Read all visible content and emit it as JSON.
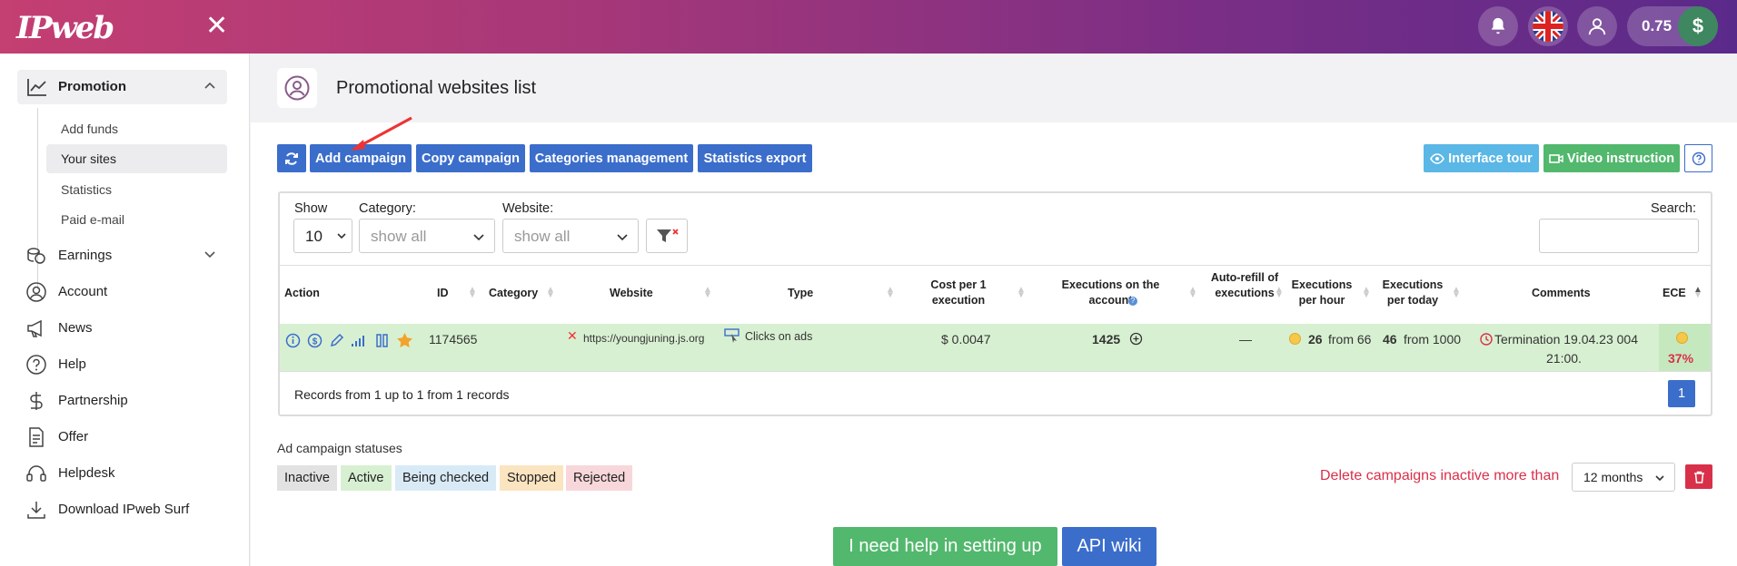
{
  "header": {
    "logo": "IPweb",
    "close_glyph": "✕",
    "balance": "0.75",
    "currency_glyph": "$",
    "icons": [
      "bell-icon",
      "uk-flag-icon",
      "user-icon"
    ]
  },
  "sidebar": {
    "section": {
      "label": "Promotion",
      "icon": "chart-icon"
    },
    "sub_items": [
      {
        "label": "Add funds"
      },
      {
        "label": "Your sites",
        "active": true
      },
      {
        "label": "Statistics"
      },
      {
        "label": "Paid e-mail"
      }
    ],
    "items": [
      {
        "label": "Earnings",
        "icon": "earnings-icon"
      },
      {
        "label": "Account",
        "icon": "account-icon"
      },
      {
        "label": "News",
        "icon": "megaphone-icon"
      },
      {
        "label": "Help",
        "icon": "help-icon"
      },
      {
        "label": "Partnership",
        "icon": "dollar-icon"
      },
      {
        "label": "Offer",
        "icon": "document-icon"
      },
      {
        "label": "Helpdesk",
        "icon": "helpdesk-icon"
      },
      {
        "label": "Download IPweb Surf",
        "icon": "download-icon"
      }
    ]
  },
  "page": {
    "title": "Promotional websites list"
  },
  "toolbar": {
    "add_campaign": "Add campaign",
    "copy_campaign": "Copy campaign",
    "categories_management": "Categories management",
    "statistics_export": "Statistics export",
    "interface_tour": "Interface tour",
    "video_instruction": "Video instruction"
  },
  "filters": {
    "show_label": "Show",
    "show_value": "10",
    "category_label": "Category:",
    "category_value": "show all",
    "website_label": "Website:",
    "website_value": "show all",
    "search_label": "Search:"
  },
  "table": {
    "headers": {
      "action": "Action",
      "id": "ID",
      "category": "Category",
      "website": "Website",
      "type": "Type",
      "cost": "Cost per 1 execution",
      "exec_account": "Executions on the account",
      "auto_refill": "Auto-refill of executions",
      "exec_hour": "Executions per hour",
      "exec_today": "Executions per today",
      "comments": "Comments",
      "ece": "ECE"
    },
    "rows": [
      {
        "id": "1174565",
        "category": "",
        "website": "https://youngjuning.js.org",
        "type": "Clicks on ads",
        "cost": "$ 0.0047",
        "exec_account": "1425",
        "auto_refill": "—",
        "exec_hour_value": "26",
        "exec_hour_rest": "from 66",
        "exec_today_value": "46",
        "exec_today_rest": "from 1000",
        "comment_line1": "Termination 19.04.23 004",
        "comment_line2": "21:00.",
        "ece": "37%"
      }
    ],
    "records_info": "Records from 1 up to 1 from 1 records",
    "page": "1"
  },
  "statuses": {
    "title": "Ad campaign statuses",
    "items": [
      {
        "label": "Inactive",
        "color": "#e2e2e2"
      },
      {
        "label": "Active",
        "color": "#d8f0d2"
      },
      {
        "label": "Being checked",
        "color": "#d9eaf7"
      },
      {
        "label": "Stopped",
        "color": "#fbe4c0"
      },
      {
        "label": "Rejected",
        "color": "#f8d7da"
      }
    ]
  },
  "cleanup": {
    "label": "Delete campaigns inactive more than",
    "period": "12 months"
  },
  "footer_buttons": {
    "help": "I need help in setting up",
    "api": "API wiki"
  },
  "colors": {
    "primary": "#3b6dcb",
    "active_row": "#d8f0d2",
    "danger": "#d9304a",
    "success": "#52b86d",
    "info": "#5bb7e6"
  }
}
